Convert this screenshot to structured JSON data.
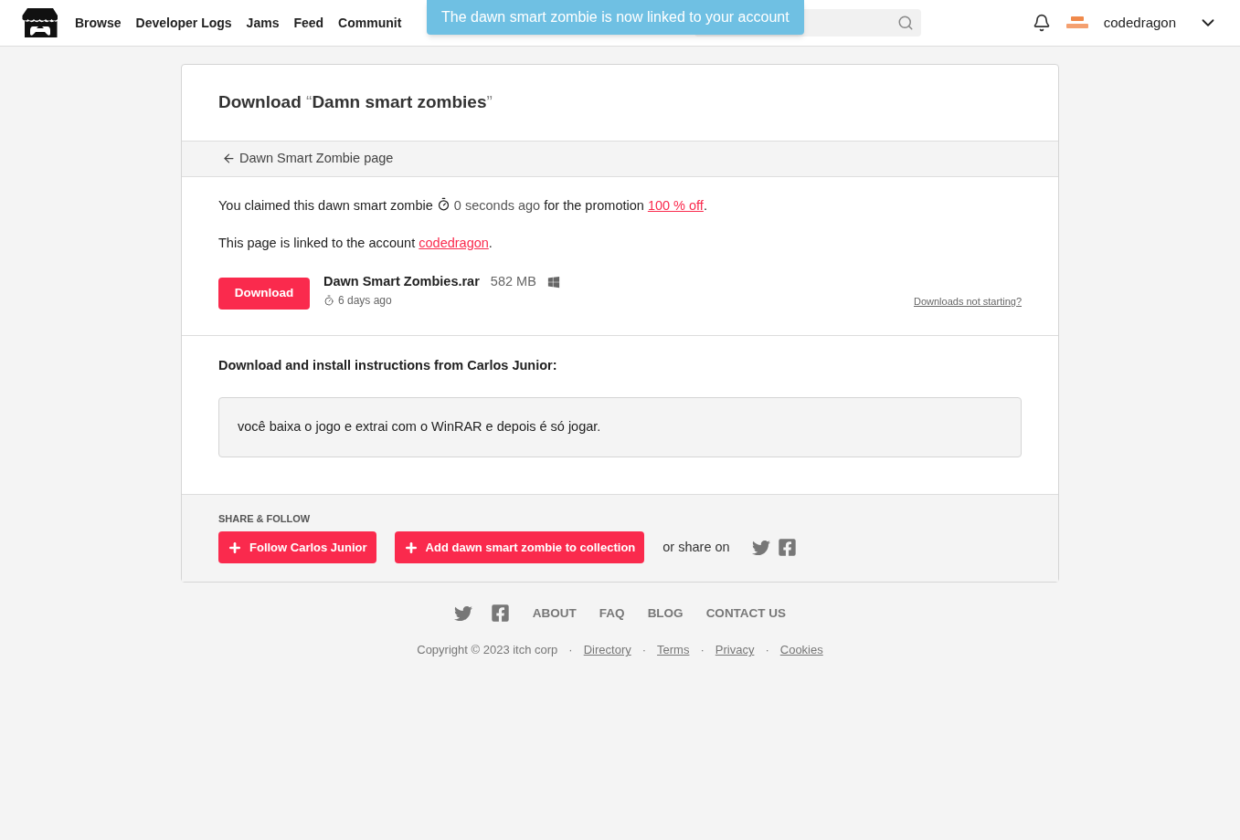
{
  "header": {
    "nav": [
      "Browse",
      "Developer Logs",
      "Jams",
      "Feed",
      "Communit"
    ],
    "username": "codedragon"
  },
  "toast": {
    "text": "The dawn smart zombie is now linked to your account"
  },
  "page": {
    "title_prefix": "Download",
    "title_open": "“",
    "title": "Damn smart zombies",
    "title_close": "”",
    "back_link": "Dawn Smart Zombie page",
    "claim": {
      "before": "You claimed this dawn smart zombie",
      "time": "0 seconds ago",
      "middle": "for the promotion",
      "promo": "100 % off",
      "after": "."
    },
    "linked": {
      "before": "This page is linked to the account",
      "account": "codedragon",
      "after": "."
    },
    "file": {
      "button": "Download",
      "name": "Dawn Smart Zombies.rar",
      "size": "582 MB",
      "age": "6 days ago"
    },
    "help_link": "Downloads not starting?",
    "instructions_title": "Download and install instructions from Carlos Junior:",
    "instructions": "você baixa o jogo e extrai com o WinRAR e depois é só jogar.",
    "share": {
      "heading": "SHARE & FOLLOW",
      "buttons": [
        "Follow Carlos Junior",
        "Add dawn smart zombie to collection"
      ],
      "share_label": "or share on"
    }
  },
  "footer": {
    "links": [
      "ABOUT",
      "FAQ",
      "BLOG",
      "CONTACT US"
    ],
    "copyright": "Copyright © 2023 itch corp",
    "separator": "·",
    "legal": [
      "Directory",
      "Terms",
      "Privacy",
      "Cookies"
    ]
  }
}
